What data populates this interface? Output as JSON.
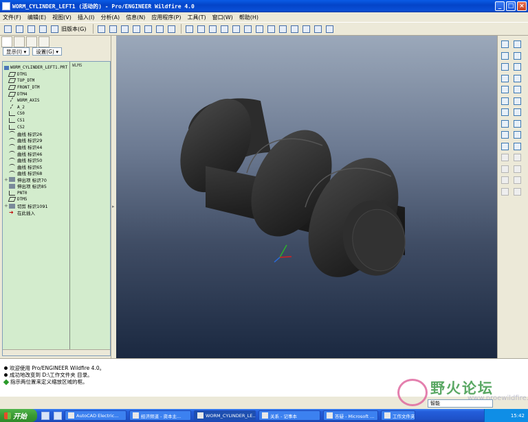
{
  "window": {
    "title": "WORM_CYLINDER_LEFT1 (活动的) - Pro/ENGINEER Wildfire 4.0",
    "minimize": "_",
    "maximize": "□",
    "close": "×"
  },
  "menu": [
    "文件(F)",
    "编辑(E)",
    "视图(V)",
    "插入(I)",
    "分析(A)",
    "信息(N)",
    "应用程序(P)",
    "工具(T)",
    "窗口(W)",
    "帮助(H)"
  ],
  "toolbar": {
    "old_version_label": "旧版本(G)"
  },
  "model_tree": {
    "show_dropdown": "显示(I) ▾",
    "settings_dropdown": "设置(G) ▾",
    "column_header": "WLMS",
    "root": "WORM_CYLINDER_LEFT1.PRT",
    "items": [
      {
        "icon": "datum-plane-icon",
        "label": "DTM1",
        "expand": ""
      },
      {
        "icon": "datum-plane-icon",
        "label": "TOP_DTM",
        "expand": ""
      },
      {
        "icon": "datum-plane-icon",
        "label": "FRONT_DTM",
        "expand": ""
      },
      {
        "icon": "datum-plane-icon",
        "label": "DTM4",
        "expand": ""
      },
      {
        "icon": "datum-axis-icon",
        "label": "WORM_AXIS",
        "expand": ""
      },
      {
        "icon": "datum-axis-icon",
        "label": "A_2",
        "expand": ""
      },
      {
        "icon": "csys-icon",
        "label": "CS0",
        "expand": ""
      },
      {
        "icon": "csys-icon",
        "label": "CS1",
        "expand": ""
      },
      {
        "icon": "csys-icon",
        "label": "CS2",
        "expand": ""
      },
      {
        "icon": "curve-icon",
        "label": "曲线 标识26",
        "expand": ""
      },
      {
        "icon": "curve-icon",
        "label": "曲线 标识29",
        "expand": ""
      },
      {
        "icon": "curve-icon",
        "label": "曲线 标识44",
        "expand": ""
      },
      {
        "icon": "curve-icon",
        "label": "曲线 标识46",
        "expand": ""
      },
      {
        "icon": "curve-icon",
        "label": "曲线 标识50",
        "expand": ""
      },
      {
        "icon": "curve-icon",
        "label": "曲线 标识65",
        "expand": ""
      },
      {
        "icon": "curve-icon",
        "label": "曲线 标识68",
        "expand": ""
      },
      {
        "icon": "extrude-icon",
        "label": "伸出项 标识70",
        "expand": "+"
      },
      {
        "icon": "extrude-icon",
        "label": "伸出项 标识85",
        "expand": ""
      },
      {
        "icon": "datum-point-icon",
        "label": "PNT0",
        "expand": ""
      },
      {
        "icon": "datum-plane-icon",
        "label": "DTM5",
        "expand": ""
      },
      {
        "icon": "cut-icon",
        "label": "切剪 标识1091",
        "expand": "+"
      },
      {
        "icon": "insert-here-icon",
        "label": "在此插入",
        "expand": ""
      }
    ]
  },
  "messages": [
    {
      "icon": "bullet",
      "text": "欢迎使用 Pro/ENGINEER Wildfire 4.0。"
    },
    {
      "icon": "bullet",
      "text": "成功地改变到 D:\\工作文件夹 目录。"
    },
    {
      "icon": "diamond",
      "text": "指示两位置来定义缩放区域的框。"
    }
  ],
  "filter": {
    "value": "智能"
  },
  "watermark": {
    "text": "野火论坛",
    "url": "www.proewildfire.cn"
  },
  "taskbar": {
    "start": "开始",
    "tasks": [
      "AutoCAD Electric...",
      "经济频道 - 资本主...",
      "WORM_CYLINDER_LE...",
      "关系 - 记事本",
      "答疑 - Microsoft ...",
      "工作文件夹"
    ],
    "active_index": 2,
    "clock": "15:42"
  }
}
